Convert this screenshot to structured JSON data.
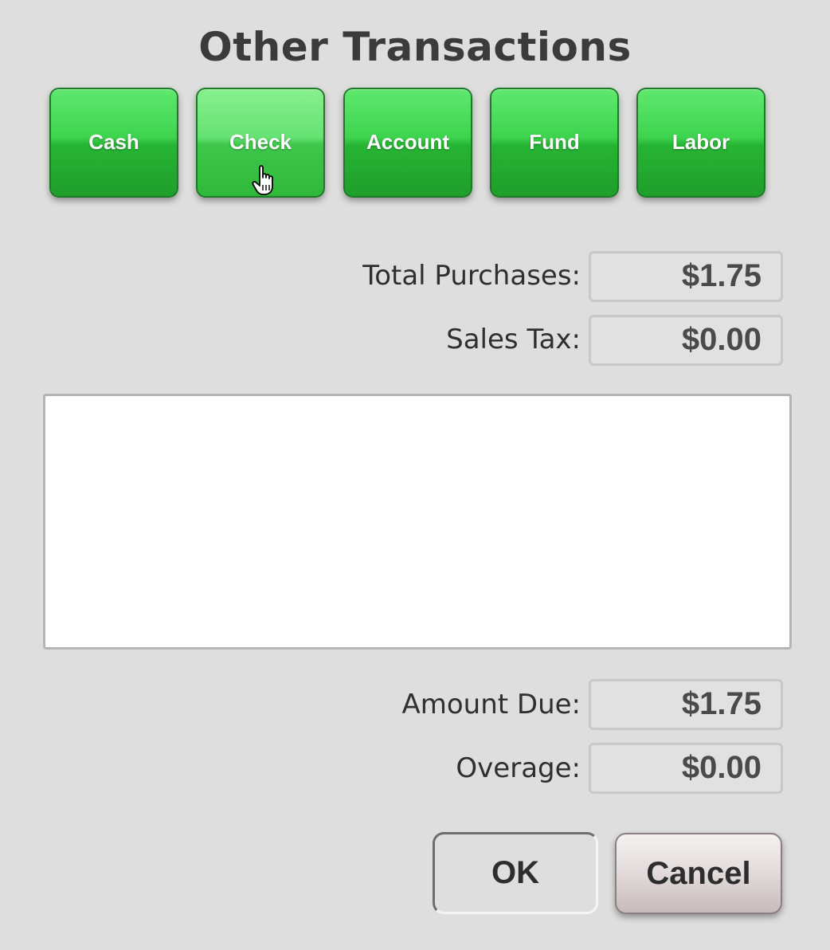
{
  "dialog": {
    "title": "Other Transactions"
  },
  "transaction_types": [
    {
      "label": "Cash"
    },
    {
      "label": "Check"
    },
    {
      "label": "Account"
    },
    {
      "label": "Fund"
    },
    {
      "label": "Labor"
    }
  ],
  "totals": {
    "total_purchases_label": "Total Purchases:",
    "total_purchases_value": "$1.75",
    "sales_tax_label": "Sales Tax:",
    "sales_tax_value": "$0.00",
    "amount_due_label": "Amount Due:",
    "amount_due_value": "$1.75",
    "overage_label": "Overage:",
    "overage_value": "$0.00"
  },
  "memo": {
    "value": ""
  },
  "actions": {
    "ok_label": "OK",
    "cancel_label": "Cancel"
  },
  "colors": {
    "button_green": "#2fb83a",
    "background": "#dedede"
  },
  "icons": {
    "cursor": "hand-pointer-icon"
  }
}
